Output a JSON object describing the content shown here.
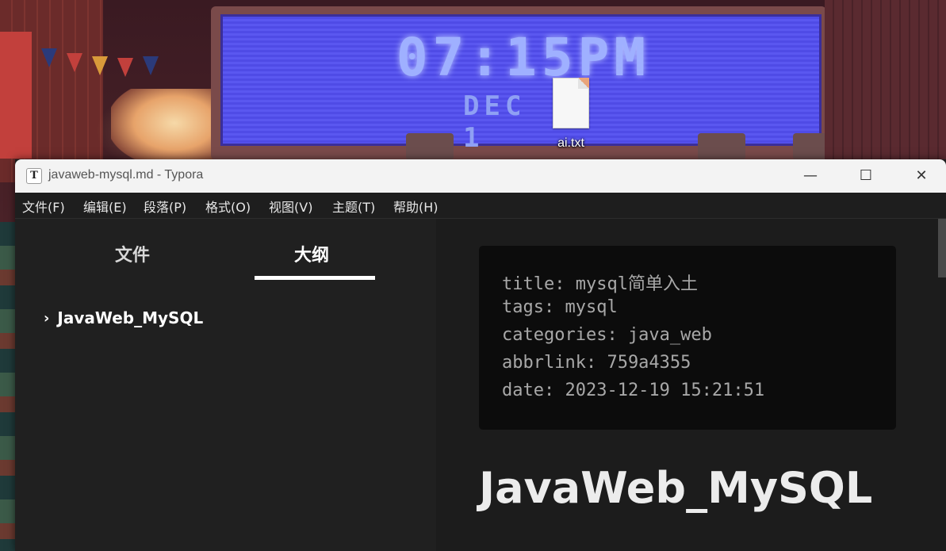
{
  "desktop": {
    "wallpaper": {
      "clock_time": "07:15PM",
      "clock_date": "DEC 1"
    },
    "icons": [
      {
        "label": "ai.txt",
        "icon": "text-file-icon"
      }
    ]
  },
  "window": {
    "app_icon_letter": "T",
    "title": "javaweb-mysql.md - Typora",
    "controls": {
      "minimize": "—",
      "maximize": "☐",
      "close": "✕"
    }
  },
  "menubar": {
    "items": [
      "文件(F)",
      "编辑(E)",
      "段落(P)",
      "格式(O)",
      "视图(V)",
      "主题(T)",
      "帮助(H)"
    ]
  },
  "sidebar": {
    "tabs": [
      {
        "label": "文件",
        "active": false
      },
      {
        "label": "大纲",
        "active": true
      }
    ],
    "outline": [
      {
        "label": "JavaWeb_MySQL",
        "expander": "›"
      }
    ]
  },
  "editor": {
    "front_matter": [
      "title: mysql简单入土",
      "tags: mysql",
      "categories: java_web",
      "abbrlink: 759a4355",
      "date: 2023-12-19 15:21:51"
    ],
    "heading": "JavaWeb_MySQL"
  },
  "colors": {
    "editor_bg": "#1c1c1c",
    "sidebar_bg": "#202020",
    "code_bg": "#0c0c0c",
    "titlebar_bg": "#f3f3f3",
    "text_primary": "#ececec"
  }
}
